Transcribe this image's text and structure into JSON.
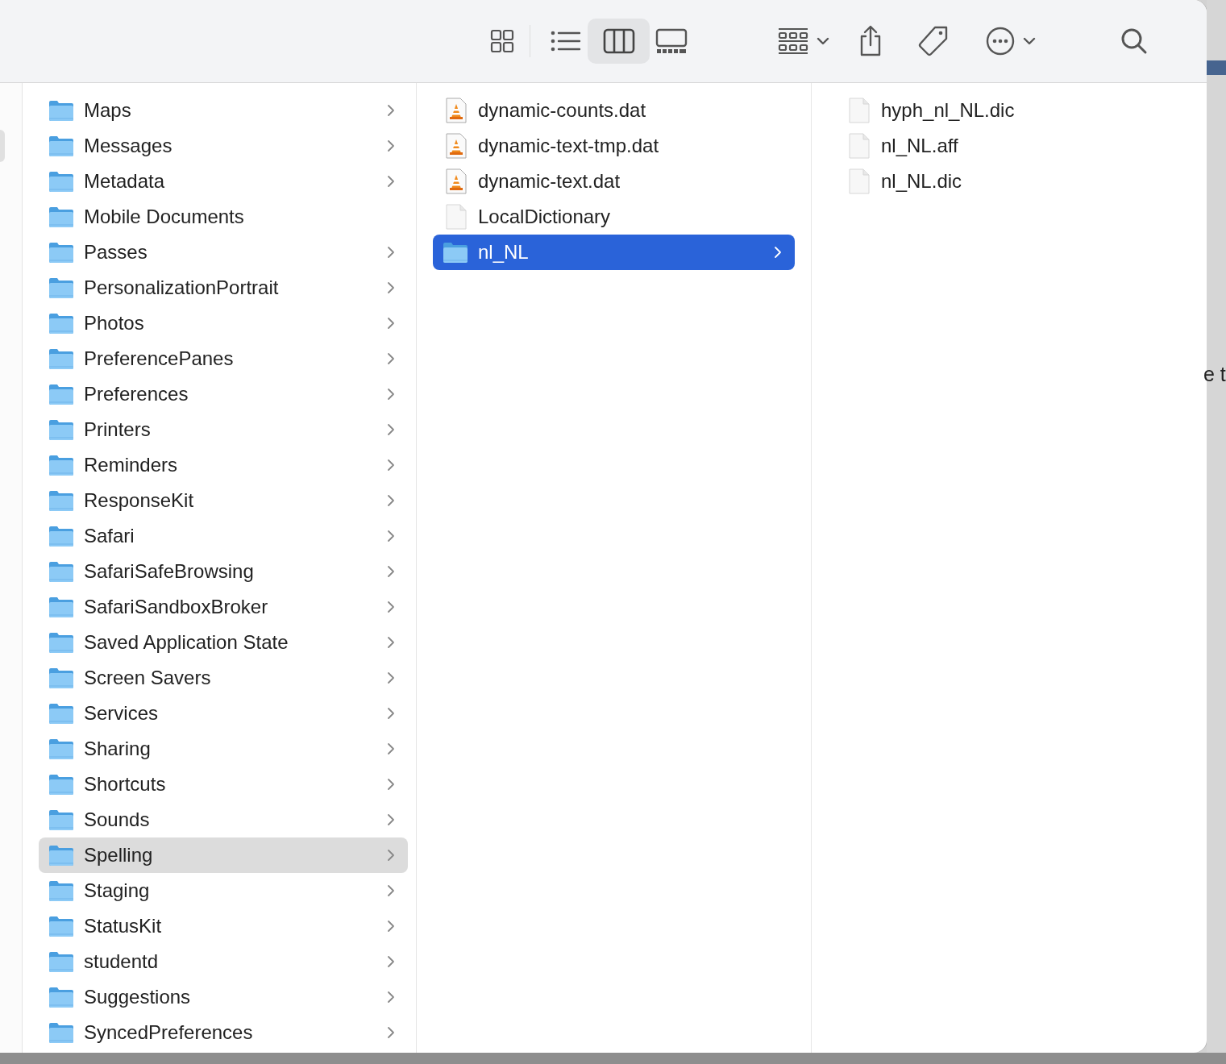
{
  "toolbar": {
    "view_buttons": [
      {
        "kind": "icons",
        "selected": false
      },
      {
        "kind": "list",
        "selected": false
      },
      {
        "kind": "columns",
        "selected": true
      },
      {
        "kind": "gallery",
        "selected": false
      }
    ],
    "actions": [
      {
        "kind": "group",
        "has_menu": true
      },
      {
        "kind": "share",
        "has_menu": false
      },
      {
        "kind": "tag",
        "has_menu": false
      },
      {
        "kind": "more",
        "has_menu": true
      },
      {
        "kind": "search",
        "has_menu": false
      }
    ]
  },
  "columns": [
    {
      "items": [
        {
          "name": "Maps",
          "kind": "folder",
          "has_children": true,
          "selected": false
        },
        {
          "name": "Messages",
          "kind": "folder",
          "has_children": true,
          "selected": false
        },
        {
          "name": "Metadata",
          "kind": "folder",
          "has_children": true,
          "selected": false
        },
        {
          "name": "Mobile Documents",
          "kind": "folder",
          "has_children": false,
          "selected": false
        },
        {
          "name": "Passes",
          "kind": "folder",
          "has_children": true,
          "selected": false
        },
        {
          "name": "PersonalizationPortrait",
          "kind": "folder",
          "has_children": true,
          "selected": false
        },
        {
          "name": "Photos",
          "kind": "folder",
          "has_children": true,
          "selected": false
        },
        {
          "name": "PreferencePanes",
          "kind": "folder",
          "has_children": true,
          "selected": false
        },
        {
          "name": "Preferences",
          "kind": "folder",
          "has_children": true,
          "selected": false
        },
        {
          "name": "Printers",
          "kind": "folder",
          "has_children": true,
          "selected": false
        },
        {
          "name": "Reminders",
          "kind": "folder",
          "has_children": true,
          "selected": false
        },
        {
          "name": "ResponseKit",
          "kind": "folder",
          "has_children": true,
          "selected": false
        },
        {
          "name": "Safari",
          "kind": "folder",
          "has_children": true,
          "selected": false
        },
        {
          "name": "SafariSafeBrowsing",
          "kind": "folder",
          "has_children": true,
          "selected": false
        },
        {
          "name": "SafariSandboxBroker",
          "kind": "folder",
          "has_children": true,
          "selected": false
        },
        {
          "name": "Saved Application State",
          "kind": "folder",
          "has_children": true,
          "selected": false
        },
        {
          "name": "Screen Savers",
          "kind": "folder",
          "has_children": true,
          "selected": false
        },
        {
          "name": "Services",
          "kind": "folder",
          "has_children": true,
          "selected": false
        },
        {
          "name": "Sharing",
          "kind": "folder",
          "has_children": true,
          "selected": false
        },
        {
          "name": "Shortcuts",
          "kind": "folder",
          "has_children": true,
          "selected": false
        },
        {
          "name": "Sounds",
          "kind": "folder",
          "has_children": true,
          "selected": false
        },
        {
          "name": "Spelling",
          "kind": "folder",
          "has_children": true,
          "selected": true
        },
        {
          "name": "Staging",
          "kind": "folder",
          "has_children": true,
          "selected": false
        },
        {
          "name": "StatusKit",
          "kind": "folder",
          "has_children": true,
          "selected": false
        },
        {
          "name": "studentd",
          "kind": "folder",
          "has_children": true,
          "selected": false
        },
        {
          "name": "Suggestions",
          "kind": "folder",
          "has_children": true,
          "selected": false
        },
        {
          "name": "SyncedPreferences",
          "kind": "folder",
          "has_children": true,
          "selected": false
        }
      ]
    },
    {
      "items": [
        {
          "name": "dynamic-counts.dat",
          "kind": "media",
          "has_children": false,
          "selected": false
        },
        {
          "name": "dynamic-text-tmp.dat",
          "kind": "media",
          "has_children": false,
          "selected": false
        },
        {
          "name": "dynamic-text.dat",
          "kind": "media",
          "has_children": false,
          "selected": false
        },
        {
          "name": "LocalDictionary",
          "kind": "document",
          "has_children": false,
          "selected": false
        },
        {
          "name": "nl_NL",
          "kind": "folder",
          "has_children": true,
          "selected": true
        }
      ]
    },
    {
      "items": [
        {
          "name": "hyph_nl_NL.dic",
          "kind": "document",
          "has_children": false,
          "selected": false
        },
        {
          "name": "nl_NL.aff",
          "kind": "document",
          "has_children": false,
          "selected": false
        },
        {
          "name": "nl_NL.dic",
          "kind": "document",
          "has_children": false,
          "selected": false
        }
      ]
    }
  ],
  "background_text": "e t"
}
